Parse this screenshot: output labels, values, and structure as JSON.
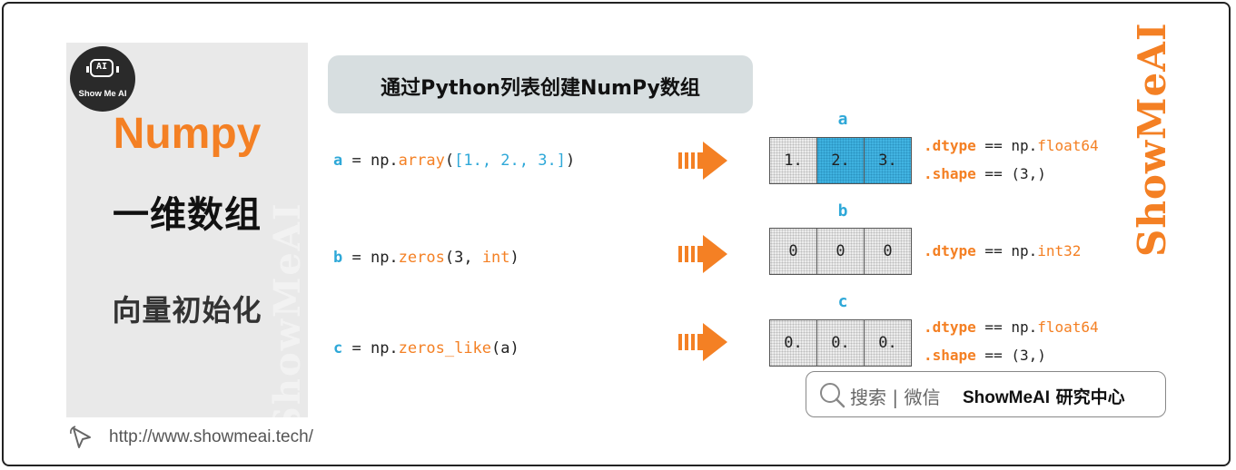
{
  "left_panel": {
    "logo_face": "AI",
    "logo_text": "Show Me AI",
    "title": "Numpy",
    "subtitle": "一维数组",
    "topic": "向量初始化",
    "watermark": "ShowMeAI",
    "url": "http://www.showmeai.tech/"
  },
  "header": {
    "title": "通过Python列表创建NumPy数组"
  },
  "code": {
    "a": {
      "var": "a",
      "op": " = np.",
      "fn": "array",
      "open": "(",
      "args": "[1., 2., 3.]",
      "close": ")"
    },
    "b": {
      "var": "b",
      "op": " = np.",
      "fn": "zeros",
      "open": "(3, ",
      "kw": "int",
      "close": ")"
    },
    "c": {
      "var": "c",
      "op": " = np.",
      "fn": "zeros_like",
      "args": "(a)"
    }
  },
  "arrays": [
    {
      "name": "a",
      "cells": [
        "1.",
        "2.",
        "3."
      ],
      "attrs": [
        {
          "attr": ".dtype",
          "op": " == np.",
          "val": "float64"
        },
        {
          "attr": ".shape",
          "op": " == (3,)"
        }
      ]
    },
    {
      "name": "b",
      "cells": [
        "0",
        "0",
        "0"
      ],
      "attrs": [
        {
          "attr": ".dtype",
          "op": " == np.",
          "val": "int32"
        }
      ]
    },
    {
      "name": "c",
      "cells": [
        "0.",
        "0.",
        "0."
      ],
      "attrs": [
        {
          "attr": ".dtype",
          "op": " == np.",
          "val": "float64"
        },
        {
          "attr": ".shape",
          "op": " == (3,)"
        }
      ]
    }
  ],
  "brand_vertical": "ShowMeAI",
  "search": {
    "label": "搜索 | 微信",
    "brand": "ShowMeAI",
    "brand_suffix": " 研究中心"
  },
  "colors": {
    "accent_orange": "#f48024",
    "accent_blue": "#2ea8d8",
    "panel_gray": "#e9e9e9",
    "header_bg": "#d7dee0"
  }
}
